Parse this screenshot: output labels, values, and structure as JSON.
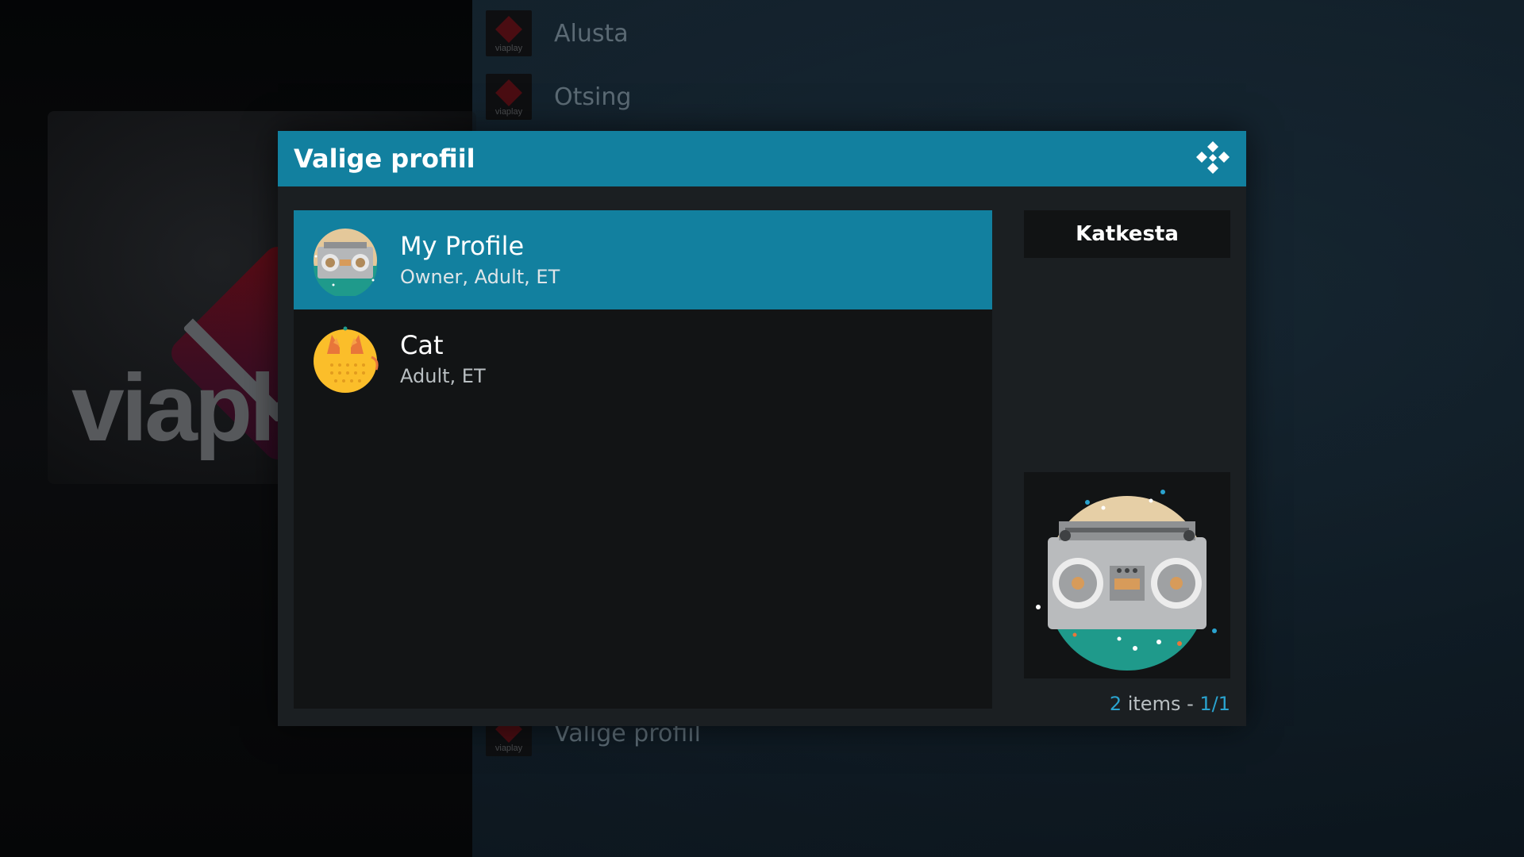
{
  "background": {
    "fanart_text": "viapl",
    "menu_items": [
      {
        "label": "Alusta",
        "thumb_text": "viaplay"
      },
      {
        "label": "Otsing",
        "thumb_text": "viaplay"
      },
      {
        "label": "Valige profiil",
        "thumb_text": "viaplay"
      }
    ]
  },
  "dialog": {
    "title": "Valige profiil",
    "logo_icon": "kodi-logo-icon",
    "profiles": [
      {
        "name": "My Profile",
        "details": "Owner, Adult, ET",
        "avatar_icon": "boombox-avatar-icon",
        "selected": true
      },
      {
        "name": "Cat",
        "details": "Adult, ET",
        "avatar_icon": "cat-avatar-icon",
        "selected": false
      }
    ],
    "cancel_label": "Katkesta",
    "preview_icon": "boombox-preview-icon",
    "count": {
      "number": "2",
      "items_word": " items - ",
      "page": "1/1"
    }
  },
  "colors": {
    "accent": "#12809f",
    "dialog_bg": "#1b1f22",
    "list_bg": "#121415"
  }
}
